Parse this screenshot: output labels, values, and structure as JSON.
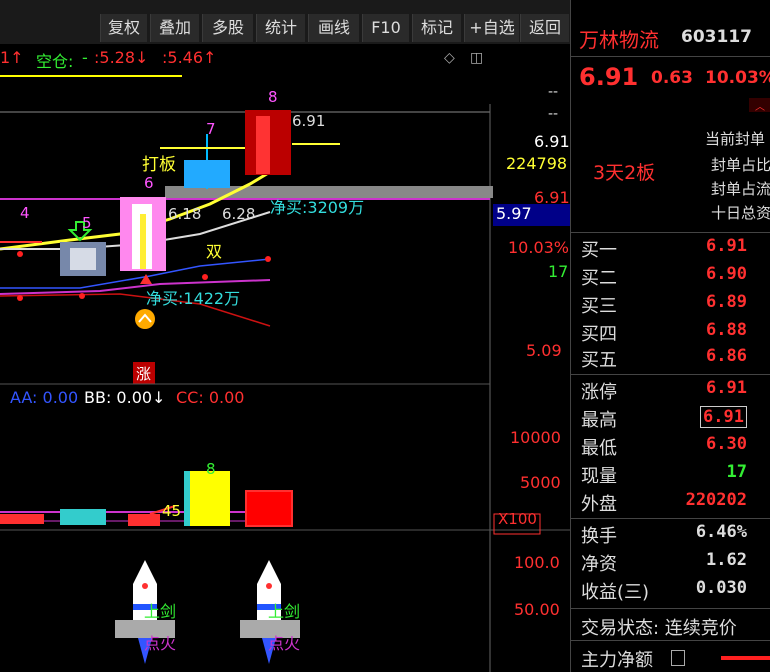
{
  "toolbar": {
    "buttons": [
      "复权",
      "叠加",
      "多股",
      "统计",
      "画线",
      "F10",
      "标记",
      "+自选",
      "返回"
    ]
  },
  "top_indicator": {
    "prefix": "1↑",
    "label": "空仓:",
    "sep": "-",
    "v1": ":5.28↓",
    "v2": ":5.46↑"
  },
  "price_axis": [
    "--",
    "--",
    "6.91",
    "224798",
    "6.91",
    "5.97",
    "10.03%",
    "17",
    "5.09"
  ],
  "chart_labels": {
    "bar8": "8",
    "bar7": "7",
    "bar6": "6",
    "bar5": "5",
    "bar4": "4",
    "high": "6.91",
    "daban": "打板",
    "net_buy_1": "净买:3209万",
    "low_range": "6.18",
    "range_hi": "6.28",
    "shuang": "双",
    "net_buy_2": "净买:1422万",
    "zhang": "涨"
  },
  "volume": {
    "aa": "AA: 0.00",
    "bb": "BB: 0.00↓",
    "cc": "CC: 0.00",
    "axis": [
      "10000",
      "5000",
      "X100"
    ],
    "vol8": "8",
    "vol45": "45"
  },
  "rocket": {
    "axis": [
      "100.0",
      "50.00"
    ],
    "label1": "上剑",
    "label2": "点火"
  },
  "stock": {
    "name": "万林物流",
    "code": "603117",
    "price": "6.91",
    "change": "0.63",
    "pct": "10.03%"
  },
  "limit": {
    "tag": "3天2板",
    "lines": [
      "当前封单",
      "封单占比",
      "封单占流",
      "十日总资"
    ]
  },
  "order_book": [
    {
      "label": "买一",
      "value": "6.91"
    },
    {
      "label": "买二",
      "value": "6.90"
    },
    {
      "label": "买三",
      "value": "6.89"
    },
    {
      "label": "买四",
      "value": "6.88"
    },
    {
      "label": "买五",
      "value": "6.86"
    }
  ],
  "quote": [
    {
      "label": "涨停",
      "value": "6.91",
      "color": "#ff3030"
    },
    {
      "label": "最高",
      "value": "6.91",
      "color": "#ff3030"
    },
    {
      "label": "最低",
      "value": "6.30",
      "color": "#ff3030"
    },
    {
      "label": "现量",
      "value": "17",
      "color": "#33ee33"
    },
    {
      "label": "外盘",
      "value": "220202",
      "color": "#ff3030"
    }
  ],
  "fundamentals": [
    {
      "label": "换手",
      "value": "6.46%"
    },
    {
      "label": "净资",
      "value": "1.62"
    },
    {
      "label": "收益(三)",
      "value": "0.030"
    }
  ],
  "trade_status": "交易状态: 连续竞价",
  "main_flow": "主力净额"
}
